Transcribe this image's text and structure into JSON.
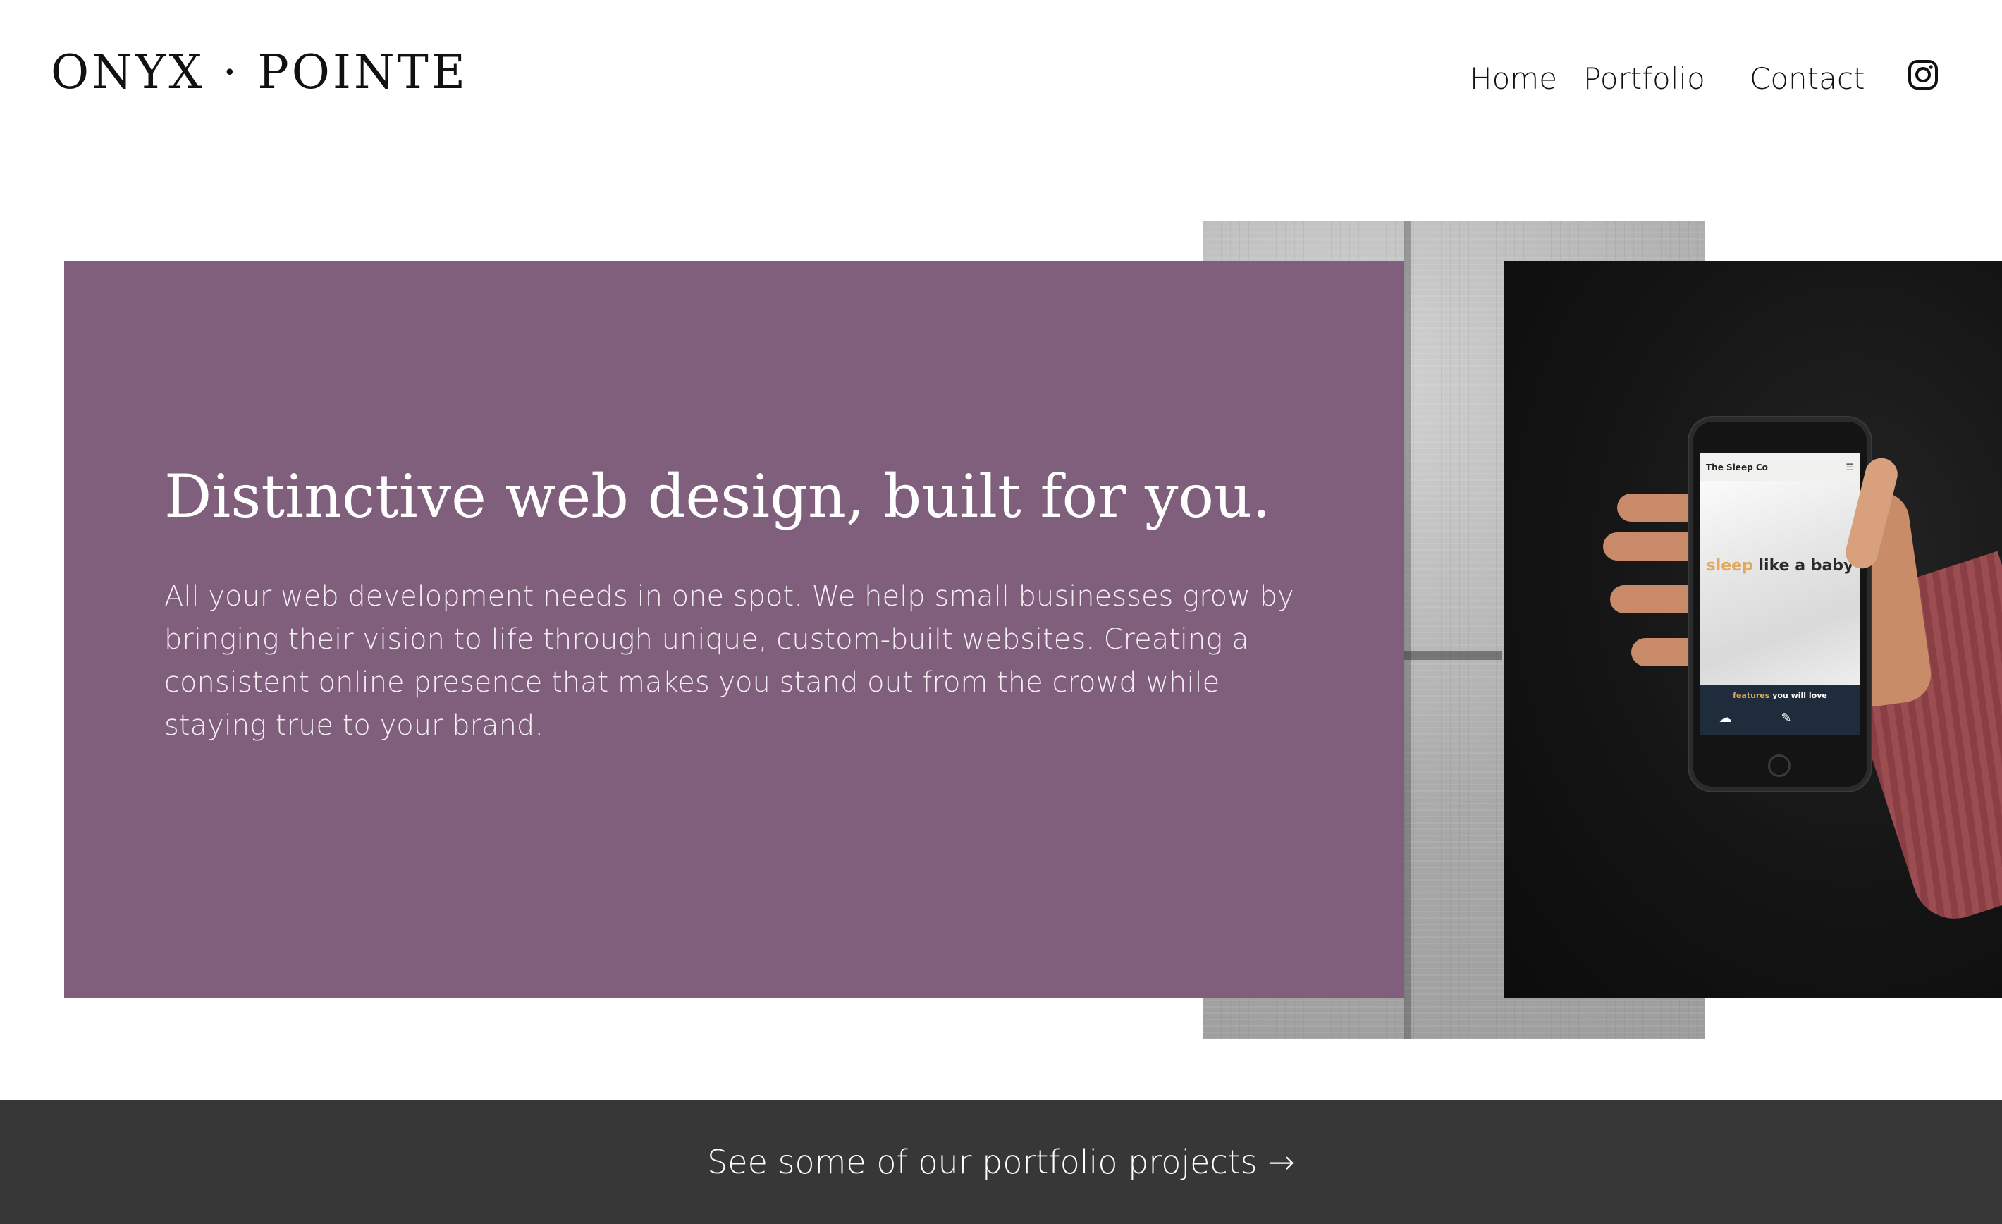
{
  "header": {
    "logo_text": "ONYX · POINTE",
    "nav": [
      {
        "label": "Home"
      },
      {
        "label": "Portfolio"
      },
      {
        "label": "Contact"
      }
    ],
    "social_icon": "instagram-icon"
  },
  "hero": {
    "title": "Distinctive web design, built for you.",
    "body": "All your web development needs in one spot. We help small businesses grow by bringing their vision to life through unique, custom-built websites. Creating a consistent online presence that makes you stand out from the crowd while staying true to your brand.",
    "panel_color": "#7f5f7b"
  },
  "phone_mockup": {
    "brand": "The Sleep Co",
    "headline_accent": "sleep",
    "headline_rest": " like a baby",
    "footer_accent": "features",
    "footer_rest": " you will love"
  },
  "banner": {
    "link_text": "See some of our portfolio projects →",
    "background": "#373737"
  }
}
